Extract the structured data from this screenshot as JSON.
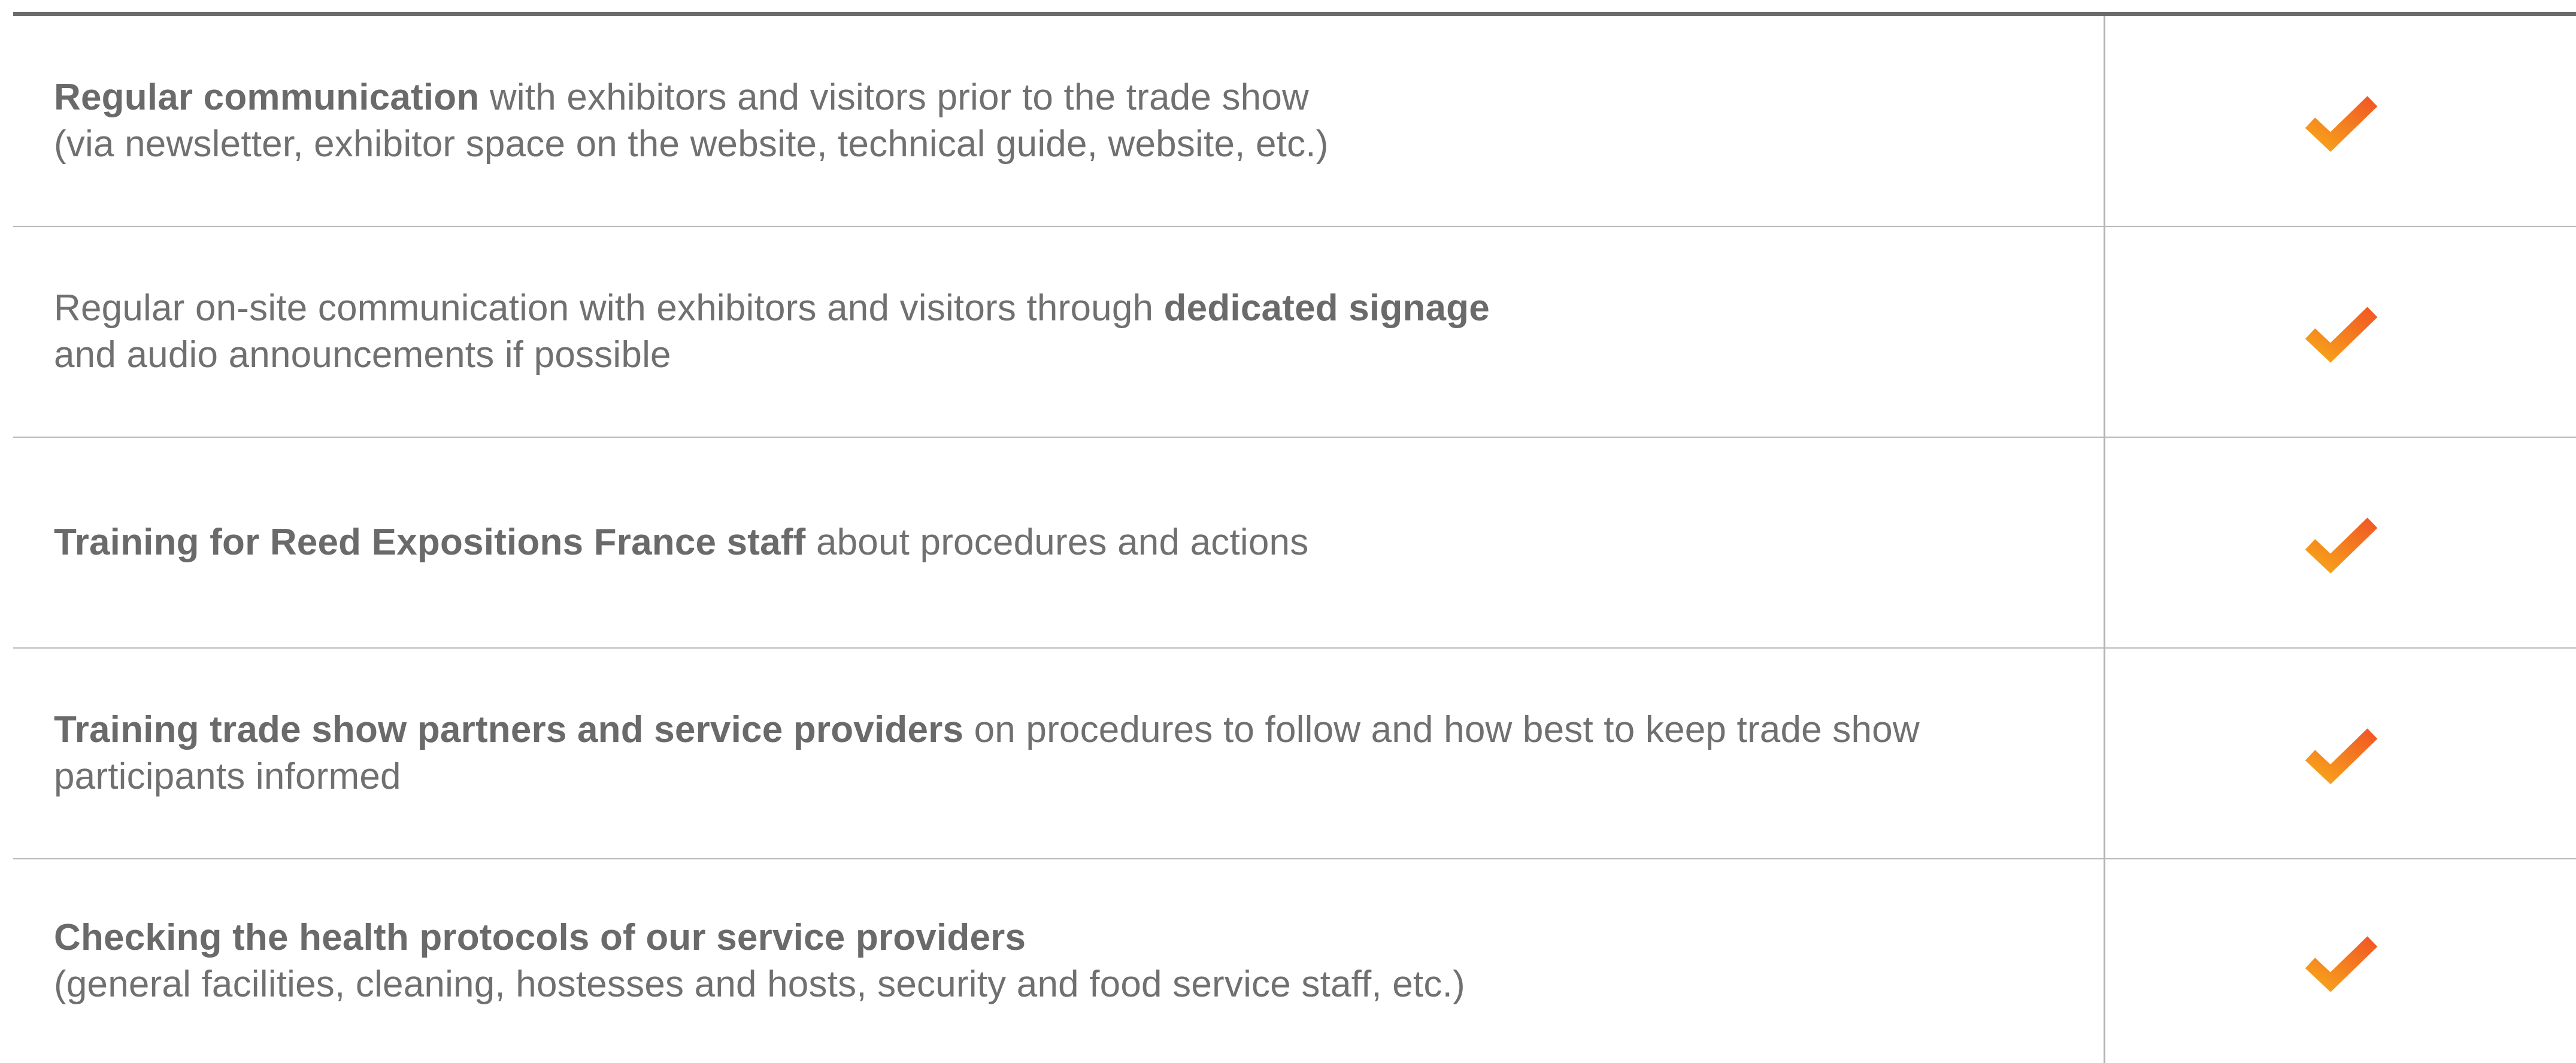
{
  "rows": [
    {
      "line1_bold": "Regular communication",
      "line1_rest": " with exhibitors and visitors prior to the trade show",
      "line2": "(via newsletter, exhibitor space on the website, technical guide, website, etc.)",
      "checked": true
    },
    {
      "line1_pre": "Regular on-site communication with exhibitors and visitors through ",
      "line1_bold": "dedicated signage",
      "line2": "and audio announcements if possible",
      "checked": true
    },
    {
      "line1_bold": "Training for Reed Expositions France staff",
      "line1_rest": " about procedures and actions",
      "checked": true
    },
    {
      "line1_bold": "Training trade show partners and service providers",
      "line1_rest": " on procedures to follow and how best to keep trade show",
      "line2": "participants informed",
      "checked": true
    },
    {
      "line1_bold": "Checking the health protocols of our service providers",
      "line2": "(general facilities, cleaning, hostesses and hosts, security and food service staff, etc.)",
      "checked": true
    }
  ],
  "colors": {
    "check_light": "#f7a21b",
    "check_dark": "#f15a24",
    "text": "#707070",
    "rule_top": "#6b6b6b",
    "rule": "#b9b9b9"
  },
  "icons": {
    "check": "checkmark-icon"
  }
}
